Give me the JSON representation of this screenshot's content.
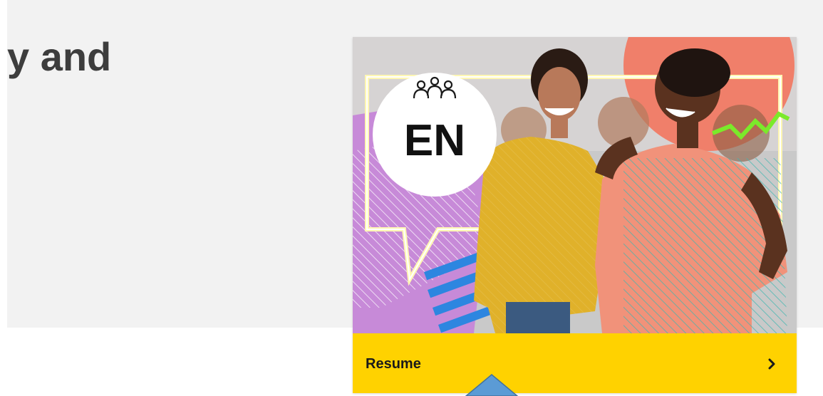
{
  "page": {
    "heading_fragment": "y and"
  },
  "course_card": {
    "badge_text": "EN",
    "badge_icon": "group-people-icon",
    "resume_label": "Resume",
    "resume_icon": "chevron-right-icon",
    "accent_color": "#ffd200"
  },
  "overlay": {
    "pointer_icon": "blue-arrow-pointer-icon",
    "pointer_color": "#5b9bd5"
  }
}
